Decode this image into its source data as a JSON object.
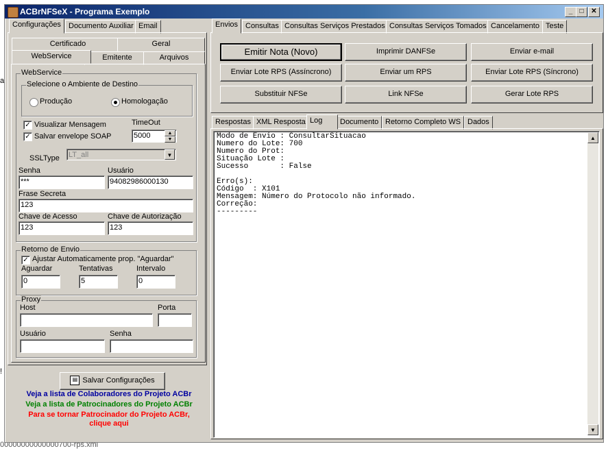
{
  "window": {
    "title": "ACBrNFSeX - Programa Exemplo",
    "min": "_",
    "max": "□",
    "close": "✕"
  },
  "left_tabs": [
    "Configurações",
    "Documento Auxiliar",
    "Email"
  ],
  "sub_tabs_row1": [
    "Certificado",
    "Geral"
  ],
  "sub_tabs_row2": [
    "WebService",
    "Emitente",
    "Arquivos"
  ],
  "webservice": {
    "group_label": "WebService",
    "ambiente_label": "Selecione o Ambiente de Destino",
    "producao": "Produção",
    "homologacao": "Homologação",
    "visualizar": "Visualizar Mensagem",
    "salvar_envelope": "Salvar envelope SOAP",
    "timeout_label": "TimeOut",
    "timeout_value": "5000",
    "ssltype_label": "SSLType",
    "ssltype_value": "LT_all",
    "senha_label": "Senha",
    "senha_value": "***",
    "usuario_label": "Usuário",
    "usuario_value": "94082986000130",
    "frase_label": "Frase Secreta",
    "frase_value": "123",
    "chave_acesso_label": "Chave de Acesso",
    "chave_acesso_value": "123",
    "chave_aut_label": "Chave de Autorização",
    "chave_aut_value": "123"
  },
  "retorno": {
    "group_label": "Retorno de Envio",
    "ajustar": "Ajustar Automaticamente prop. \"Aguardar\"",
    "aguardar_label": "Aguardar",
    "aguardar_value": "0",
    "tentativas_label": "Tentativas",
    "tentativas_value": "5",
    "intervalo_label": "Intervalo",
    "intervalo_value": "0"
  },
  "proxy": {
    "group_label": "Proxy",
    "host_label": "Host",
    "porta_label": "Porta",
    "usuario_label": "Usuário",
    "senha_label": "Senha"
  },
  "salvar_config": "Salvar Configurações",
  "links": {
    "colaboradores": "Veja a lista de Colaboradores do Projeto ACBr",
    "patrocinadores": "Veja a lista de Patrocinadores do Projeto ACBr",
    "tornar1": "Para se tornar Patrocinador do Projeto ACBr,",
    "tornar2": "clique aqui"
  },
  "right_tabs": [
    "Envios",
    "Consultas",
    "Consultas Serviços Prestados",
    "Consultas Serviços Tomados",
    "Cancelamento",
    "Teste"
  ],
  "buttons": {
    "emitir": "Emitir Nota (Novo)",
    "imprimir": "Imprimir DANFSe",
    "email": "Enviar e-mail",
    "lote_assinc": "Enviar Lote RPS (Assíncrono)",
    "enviar_um": "Enviar um RPS",
    "lote_sinc": "Enviar Lote RPS (Síncrono)",
    "substituir": "Substituir NFSe",
    "link": "Link NFSe",
    "gerar_lote": "Gerar Lote RPS"
  },
  "result_tabs": [
    "Respostas",
    "XML Resposta",
    "Log",
    "Documento",
    "Retorno Completo WS",
    "Dados"
  ],
  "log_lines": [
    "Modo de Envio : ConsultarSituacao",
    "Numero do Lote: 700",
    "Numero do Prot:",
    "Situação Lote :",
    "Sucesso       : False",
    "",
    "Erro(s):",
    "Código  : X101",
    "Mensagem: Número do Protocolo não informado.",
    "Correção:",
    "---------"
  ],
  "background": {
    "left_char": "a",
    "left_char2": "!",
    "status_file": "00000000000000700-rps.xml"
  },
  "colors": {
    "blue_link": "#0000a0",
    "green_link": "#008000",
    "red_link": "#ff0000",
    "title_blue": "#0a246a"
  }
}
